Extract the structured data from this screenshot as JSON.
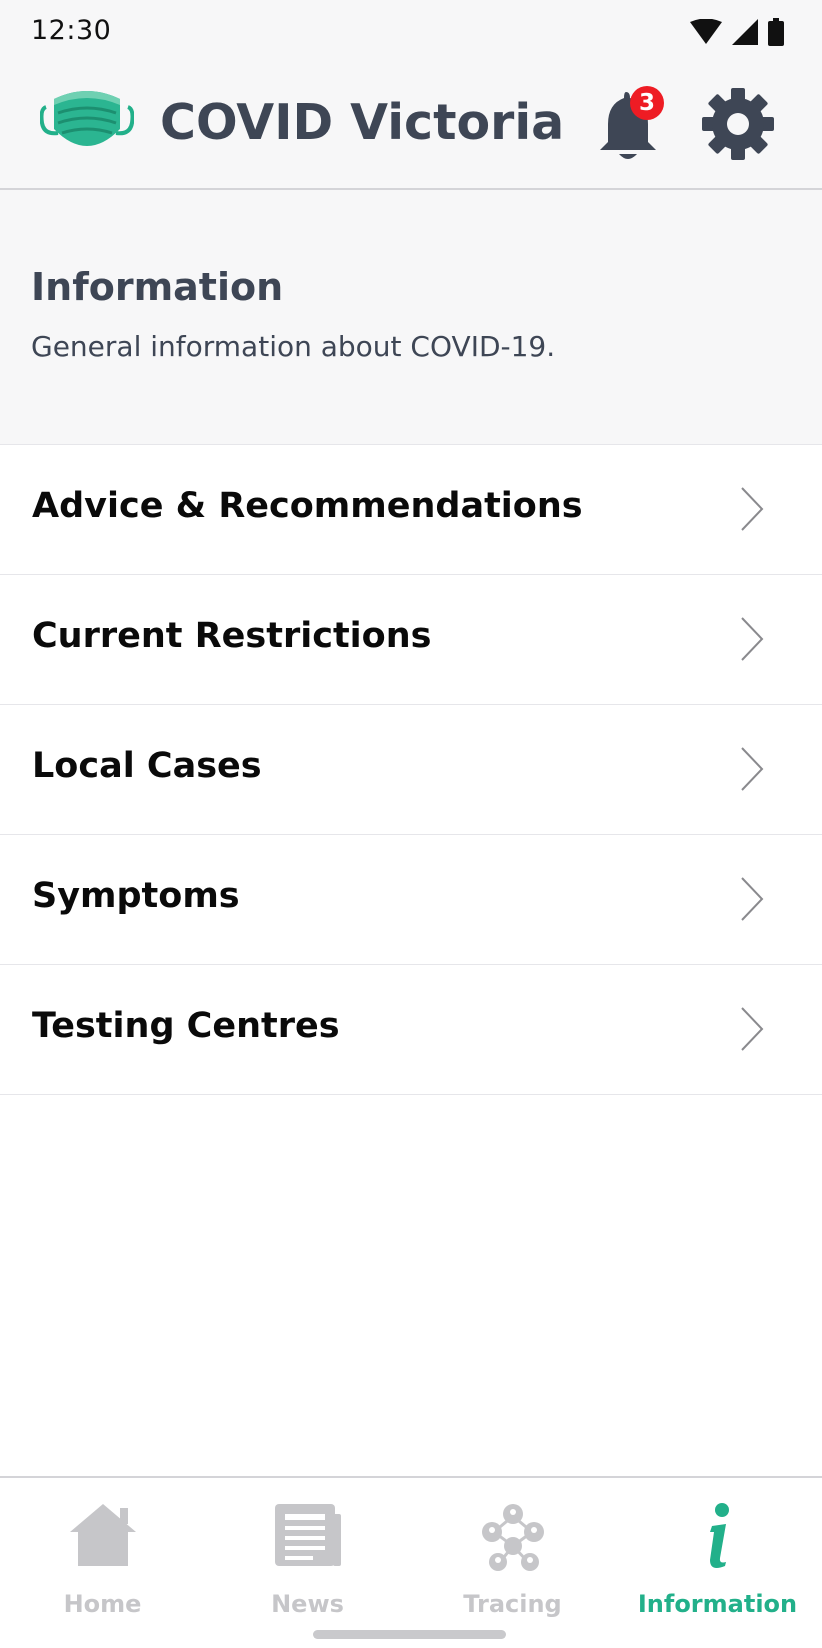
{
  "status_bar": {
    "time": "12:30"
  },
  "header": {
    "title": "COVID Victoria",
    "notification_count": "3",
    "logo_icon": "face-mask-icon",
    "colors": {
      "brand": "#22b08a",
      "title": "#3e4655",
      "badge": "#ee1c24"
    }
  },
  "section": {
    "title": "Information",
    "subtitle": "General information about COVID-19."
  },
  "menu": {
    "items": [
      {
        "label": "Advice & Recommendations"
      },
      {
        "label": "Current Restrictions"
      },
      {
        "label": "Local Cases"
      },
      {
        "label": "Symptoms"
      },
      {
        "label": "Testing Centres"
      }
    ]
  },
  "tabs": {
    "items": [
      {
        "label": "Home",
        "icon": "home-icon"
      },
      {
        "label": "News",
        "icon": "newspaper-icon"
      },
      {
        "label": "Tracing",
        "icon": "tracing-network-icon"
      },
      {
        "label": "Information",
        "icon": "info-icon"
      }
    ],
    "active": "Information",
    "colors": {
      "active": "#22b08a",
      "inactive": "#c6c6c9"
    }
  }
}
